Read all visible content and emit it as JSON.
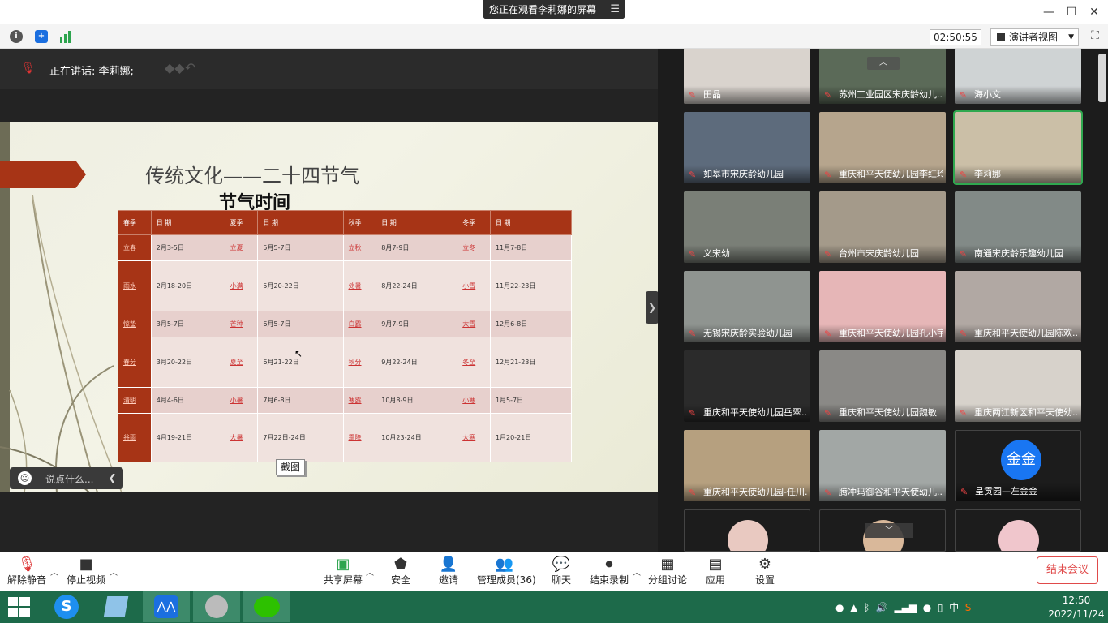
{
  "window": {
    "share_banner": "您正在观看李莉娜的屏幕",
    "minimize": "—",
    "maximize": "☐",
    "close": "✕"
  },
  "infobar": {
    "timer": "02:50:55",
    "view_mode": "演讲者视图"
  },
  "speaker": {
    "label": "正在讲话: 李莉娜;"
  },
  "slide": {
    "title": "传统文化——二十四节气",
    "subtitle": "节气时间",
    "headers": [
      "春季",
      "日  期",
      "夏季",
      "日  期",
      "秋季",
      "日  期",
      "冬季",
      "日  期"
    ],
    "rows": [
      [
        "立春",
        "2月3-5日",
        "立夏",
        "5月5-7日",
        "立秋",
        "8月7-9日",
        "立冬",
        "11月7-8日"
      ],
      [
        "雨水",
        "2月18-20日",
        "小满",
        "5月20-22日",
        "处暑",
        "8月22-24日",
        "小雪",
        "11月22-23日"
      ],
      [
        "惊蛰",
        "3月5-7日",
        "芒种",
        "6月5-7日",
        "白露",
        "9月7-9日",
        "大雪",
        "12月6-8日"
      ],
      [
        "春分",
        "3月20-22日",
        "夏至",
        "6月21-22日",
        "秋分",
        "9月22-24日",
        "冬至",
        "12月21-23日"
      ],
      [
        "清明",
        "4月4-6日",
        "小暑",
        "7月6-8日",
        "寒露",
        "10月8-9日",
        "小寒",
        "1月5-7日"
      ],
      [
        "谷雨",
        "4月19-21日",
        "大暑",
        "7月22日-24日",
        "霜降",
        "10月23-24日",
        "大寒",
        "1月20-21日"
      ]
    ]
  },
  "capture_label": "截图",
  "chat_placeholder": "说点什么...",
  "participants": [
    {
      "name": "田晶",
      "color": "#d9d3cd"
    },
    {
      "name": "苏州工业园区宋庆龄幼儿...",
      "color": "#5b6a58"
    },
    {
      "name": "海小文",
      "color": "#cfd3d4"
    },
    {
      "name": "如皋市宋庆龄幼儿园",
      "color": "#5d6b7c"
    },
    {
      "name": "重庆和平天使幼儿园李红玲",
      "color": "#b6a58d"
    },
    {
      "name": "李莉娜",
      "color": "#cbbfa7"
    },
    {
      "name": "义宋幼",
      "color": "#7a7f77"
    },
    {
      "name": "台州市宋庆龄幼儿园",
      "color": "#a49a8a"
    },
    {
      "name": "南通宋庆龄乐趣幼儿园",
      "color": "#828a87"
    },
    {
      "name": "无锡宋庆龄实验幼儿园",
      "color": "#8f9490"
    },
    {
      "name": "重庆和平天使幼儿园孔小宇",
      "color": "#e6b6b7"
    },
    {
      "name": "重庆和平天使幼儿园陈欢...",
      "color": "#b1a8a3"
    },
    {
      "name": "重庆和平天使幼儿园岳翠...",
      "color": "#2b2b2b"
    },
    {
      "name": "重庆和平天使幼儿园魏敏",
      "color": "#8a8986"
    },
    {
      "name": "重庆两江新区和平天使幼...",
      "color": "#d7d2cb"
    },
    {
      "name": "重庆和平天使幼儿园-任川...",
      "color": "#b6a07f"
    },
    {
      "name": "腾冲玛御谷和平天使幼儿...",
      "color": "#a2a7a5"
    },
    {
      "name": "呈贡园—左金金",
      "color": "#1c1c1c"
    }
  ],
  "avatar_text": "金金",
  "toolbar": {
    "unmute": "解除静音",
    "stop_video": "停止视频",
    "share": "共享屏幕",
    "security": "安全",
    "invite": "邀请",
    "manage": "管理成员(36)",
    "chat": "聊天",
    "stop_record": "结束录制",
    "breakout": "分组讨论",
    "apps": "应用",
    "settings": "设置",
    "end": "结束会议"
  },
  "taskbar": {
    "time": "12:50",
    "date": "2022/11/24",
    "ime": "中"
  }
}
